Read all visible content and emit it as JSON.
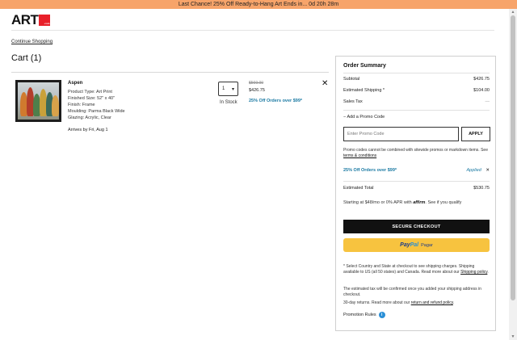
{
  "promo_bar": {
    "text": "Last Chance! 25% Off Ready-to-Hang Art Ends in... 0d 20h 28m"
  },
  "header": {
    "logo_text": "ART",
    "logo_badge": ".com"
  },
  "nav": {
    "continue_shopping": "Continue Shopping"
  },
  "cart": {
    "title": "Cart (1)",
    "item": {
      "name": "Aspen",
      "details": [
        "Product Type: Art Print",
        "Finished Size: 52\" x 40\"",
        "Finish: Frame",
        "Moulding: Parma Black Wide",
        "Glazing: Acrylic, Clear"
      ],
      "arrives": "Arrives by Fri, Aug 1",
      "quantity": "1",
      "stock": "In Stock",
      "original_price": "$569.00",
      "price": "$426.75",
      "promo": "25% Off Orders over $99*"
    }
  },
  "summary": {
    "title": "Order Summary",
    "rows": [
      {
        "label": "Subtotal",
        "value": "$426.75"
      },
      {
        "label": "Estimated Shipping *",
        "value": "$104.00"
      },
      {
        "label": "Sales Tax",
        "value": "—"
      }
    ],
    "add_promo": "Add a Promo Code",
    "promo_placeholder": "Enter Promo Code",
    "apply_label": "APPLY",
    "promo_note_pre": "Promo codes cannot be combined with sitewide promos or markdown items. See",
    "promo_note_link": "terms & conditions",
    "applied_promo": "25% Off Orders over $99*",
    "applied_status": "Applied",
    "estimated_total_label": "Estimated Total",
    "estimated_total": "$530.75",
    "affirm_pre": "Starting at $48/mo or 0% APR with",
    "affirm_brand": "affirm",
    "affirm_post": "See if you qualify",
    "checkout_label": "SECURE CHECKOUT",
    "paypal_pay": "Pay",
    "paypal_pal": "Pal",
    "paypal_pagar": "Pagar",
    "shipping_note_pre": "* Select Country and State at checkout to see shipping charges. Shipping available to US (all 50 states) and Canada. Read more about our",
    "shipping_note_link": "Shipping policy",
    "tax_note": "The estimated tax will be confirmed once you added your shipping address in checkout.",
    "returns_pre": "30-day returns. Read more about our",
    "returns_link": "return and refund policy",
    "promotion_rules": "Promotion Rules"
  },
  "colors": {
    "promo_bar": "#f7a46a",
    "accent": "#1b7aa3",
    "logo_red": "#e8202a",
    "paypal": "#f7c33f"
  }
}
